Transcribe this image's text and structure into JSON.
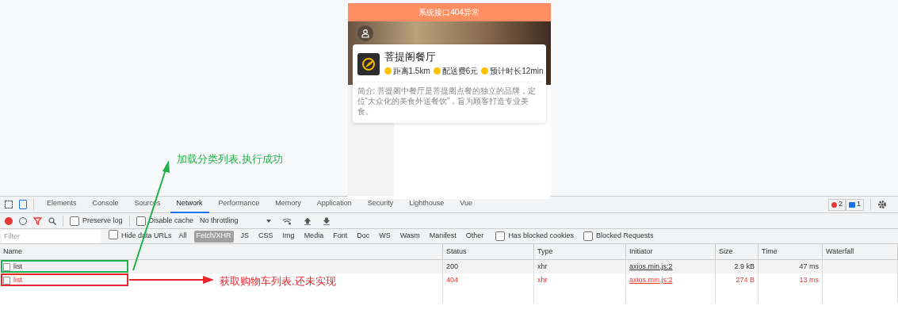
{
  "phone": {
    "header": "系统接口404异常",
    "shop": {
      "name": "菩提阁餐厅",
      "info": [
        "距离1.5km",
        "配送费6元",
        "预计时长12min"
      ],
      "description": "简介: 菩提阁中餐厅是菩提阁点餐的独立的品牌，定位“大众化的美食外送餐饮”，旨为顾客打造专业美食。"
    }
  },
  "devtools": {
    "tabs": [
      {
        "label": "Elements",
        "selected": false
      },
      {
        "label": "Console",
        "selected": false
      },
      {
        "label": "Sources",
        "selected": false
      },
      {
        "label": "Network",
        "selected": true
      },
      {
        "label": "Performance",
        "selected": false
      },
      {
        "label": "Memory",
        "selected": false
      },
      {
        "label": "Application",
        "selected": false
      },
      {
        "label": "Security",
        "selected": false
      },
      {
        "label": "Lighthouse",
        "selected": false
      },
      {
        "label": "Vue",
        "selected": false
      }
    ],
    "error_count": "2",
    "message_count": "1",
    "toolbar": {
      "preserve_log": {
        "label": "Preserve log",
        "checked": false
      },
      "disable_cache": {
        "label": "Disable cache",
        "checked": false
      },
      "throttling": "No throttling"
    },
    "filter": {
      "placeholder": "Filter",
      "hide_data_urls": {
        "label": "Hide data URLs",
        "checked": false
      },
      "types": [
        {
          "label": "All",
          "selected": false
        },
        {
          "label": "Fetch/XHR",
          "selected": true
        },
        {
          "label": "JS",
          "selected": false
        },
        {
          "label": "CSS",
          "selected": false
        },
        {
          "label": "Img",
          "selected": false
        },
        {
          "label": "Media",
          "selected": false
        },
        {
          "label": "Font",
          "selected": false
        },
        {
          "label": "Doc",
          "selected": false
        },
        {
          "label": "WS",
          "selected": false
        },
        {
          "label": "Wasm",
          "selected": false
        },
        {
          "label": "Manifest",
          "selected": false
        },
        {
          "label": "Other",
          "selected": false
        }
      ],
      "extras": [
        {
          "label": "Has blocked cookies",
          "checked": false
        },
        {
          "label": "Blocked Requests",
          "checked": false
        }
      ]
    },
    "columns": [
      "Name",
      "Status",
      "Type",
      "Initiator",
      "Size",
      "Time",
      "Waterfall"
    ],
    "rows": [
      {
        "name": "list",
        "status": "200",
        "type": "xhr",
        "initiator": "axios.min.js:2",
        "size": "2.9 kB",
        "time": "47 ms",
        "error": false,
        "checked": false
      },
      {
        "name": "list",
        "status": "404",
        "type": "xhr",
        "initiator": "axios.min.js:2",
        "size": "274 B",
        "time": "13 ms",
        "error": true,
        "checked": false
      }
    ]
  },
  "annotations": [
    {
      "text": "加载分类列表,执行成功",
      "color": "#22b04b"
    },
    {
      "text": "获取购物车列表,还未实现",
      "color": "#e8262b"
    }
  ]
}
